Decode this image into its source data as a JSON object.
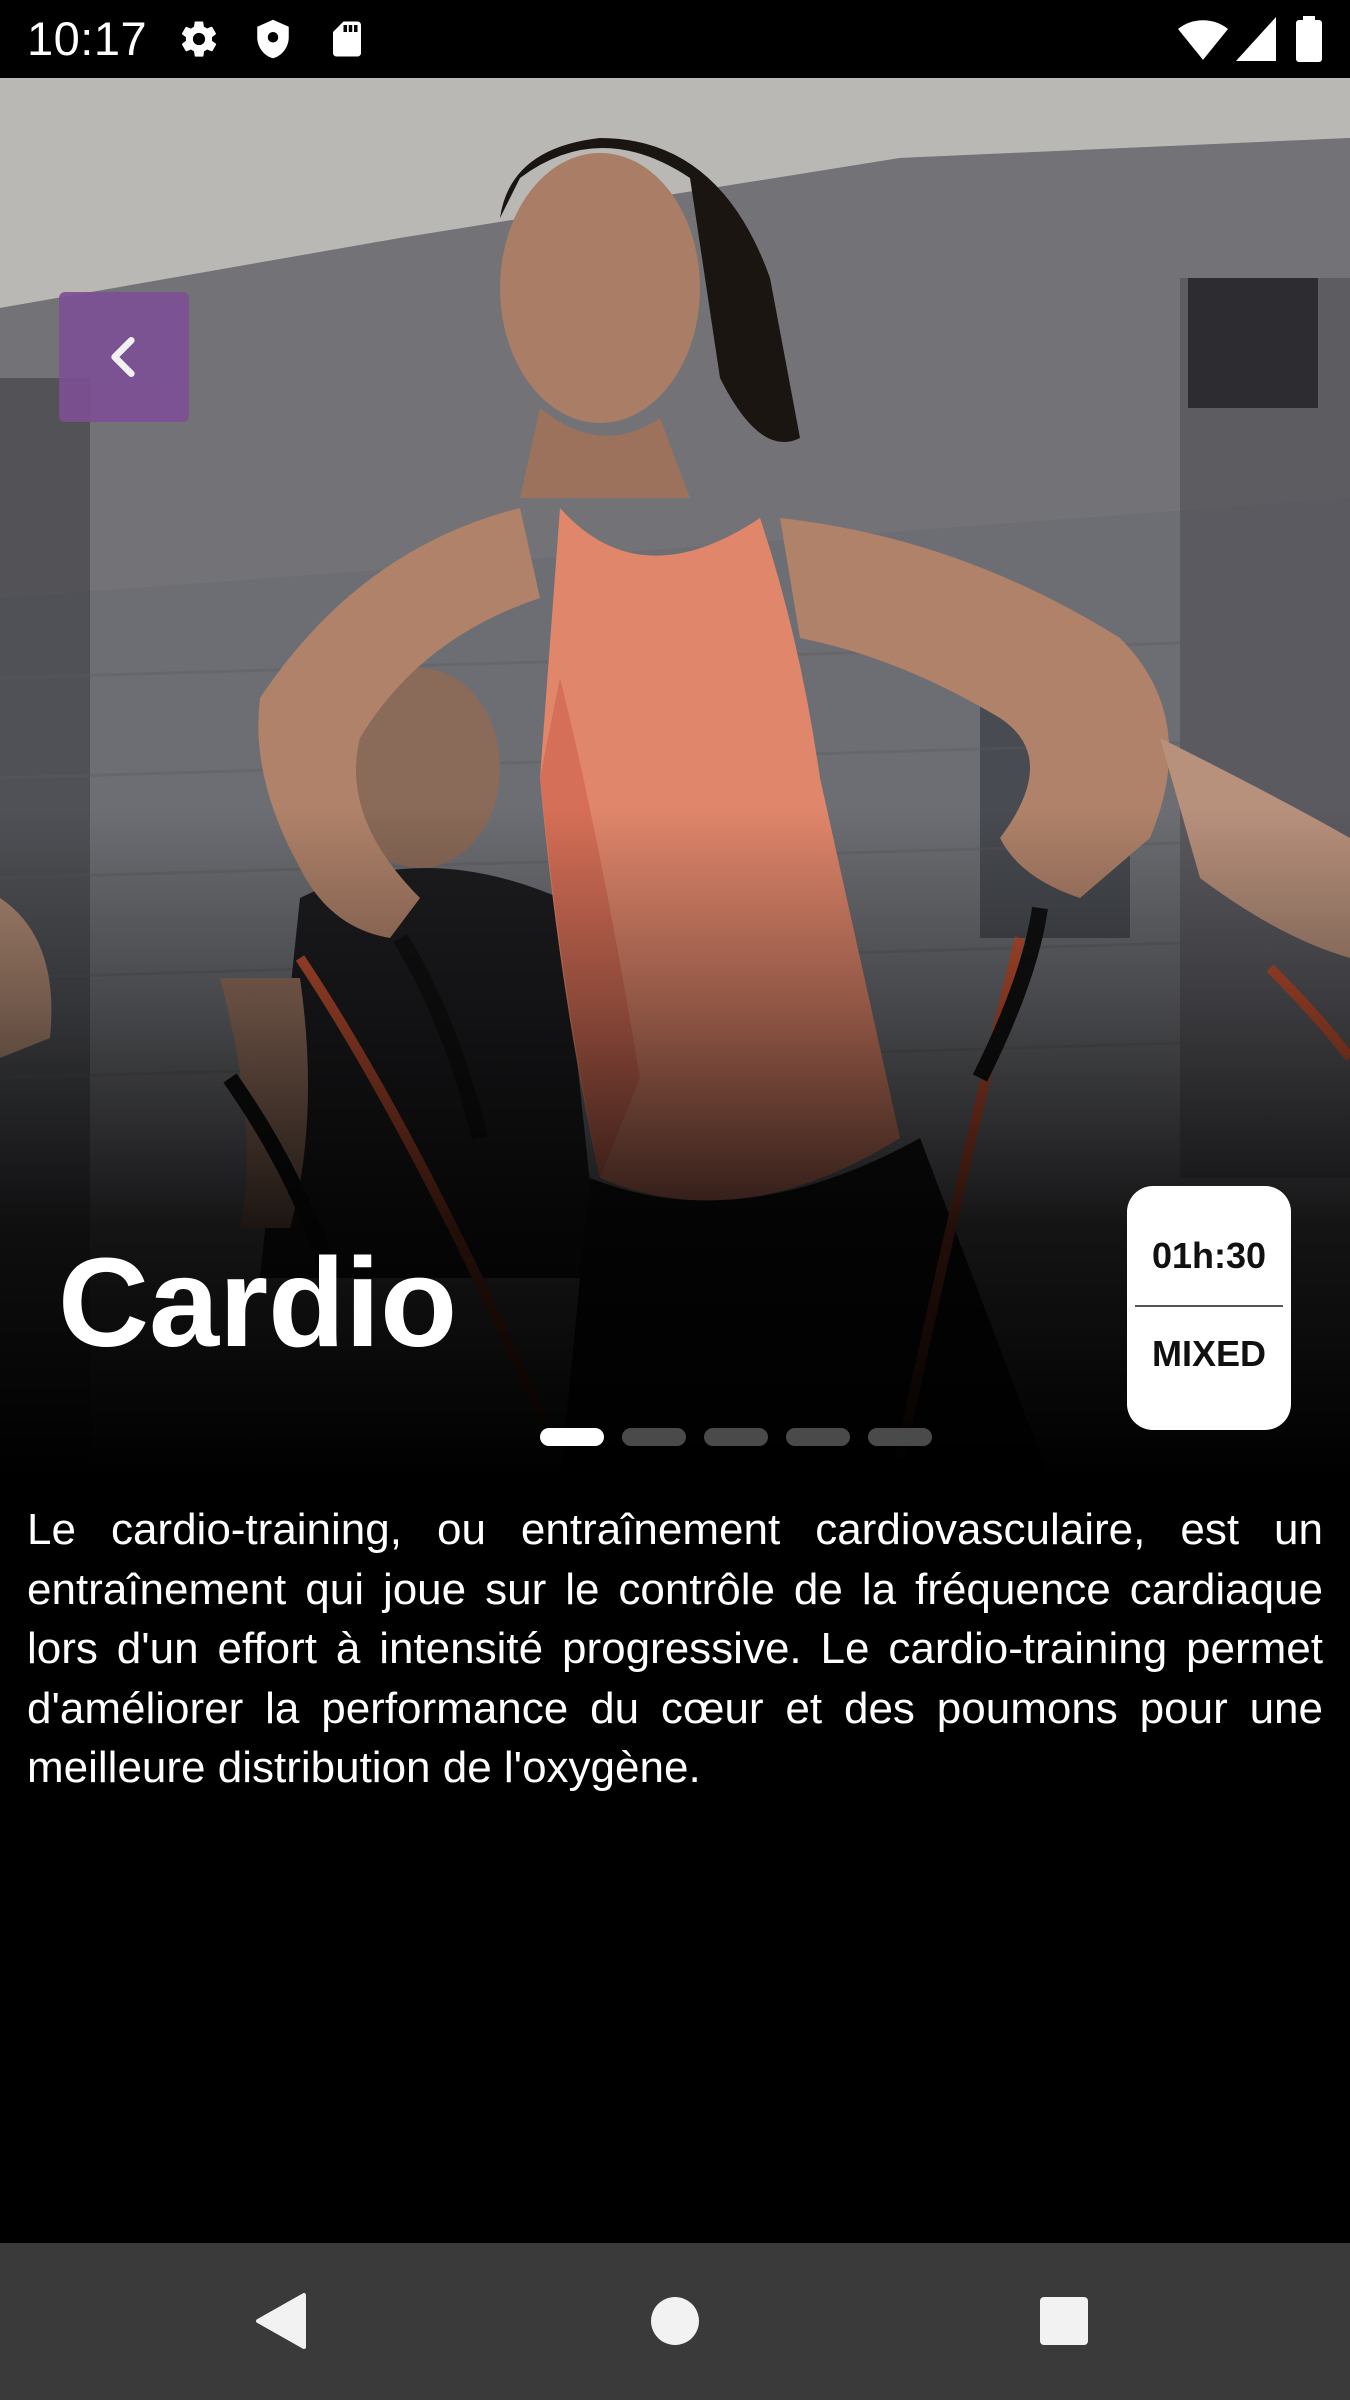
{
  "status_bar": {
    "time": "10:17",
    "left_icons": [
      "gear-icon",
      "shield-icon",
      "sd-card-icon"
    ],
    "right_icons": [
      "wifi-icon",
      "cell-signal-icon",
      "battery-icon"
    ]
  },
  "hero": {
    "title": "Cardio",
    "back_icon": "chevron-left-icon",
    "accent_color": "#7d4f95",
    "info_card": {
      "duration": "01h:30",
      "level": "MIXED"
    },
    "pager": {
      "count": 5,
      "active_index": 0
    }
  },
  "description": "Le cardio-training, ou entraînement cardiovasculaire, est un entraînement qui joue sur le contrôle de la fréquence cardiaque lors d'un effort à intensité progressive. Le cardio-training permet d'améliorer la performance du cœur et des poumons pour une meilleure distribution de l'oxygène.",
  "nav_bar": {
    "buttons": [
      "back-triangle-icon",
      "home-circle-icon",
      "recents-square-icon"
    ]
  }
}
